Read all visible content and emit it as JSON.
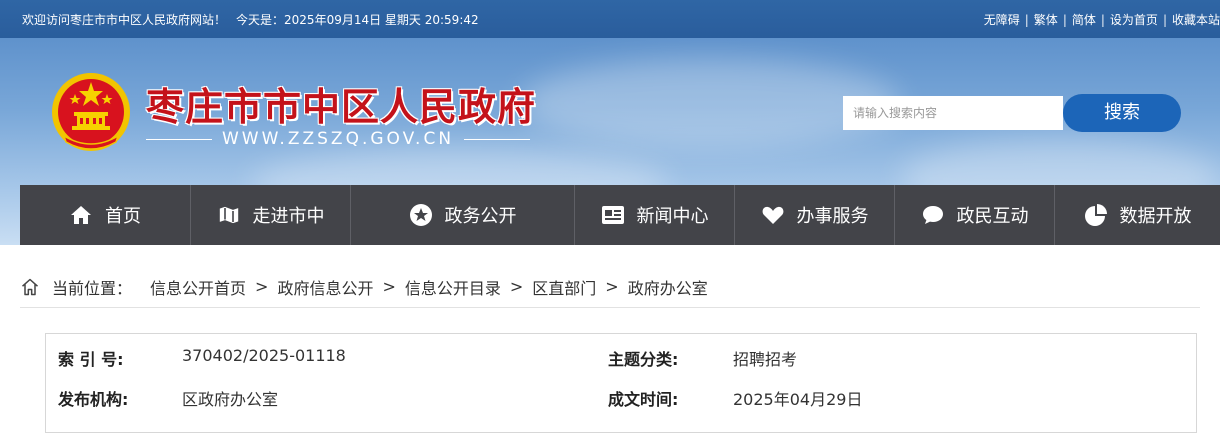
{
  "topbar": {
    "welcome": "欢迎访问枣庄市市中区人民政府网站！",
    "today_label": "今天是：",
    "datetime": "2025年09月14日 星期天 20:59:42",
    "links": [
      "无障碍",
      "繁体",
      "简体",
      "设为首页",
      "收藏本站"
    ]
  },
  "header": {
    "title": "枣庄市市中区人民政府",
    "domain": "WWW.ZZSZQ.GOV.CN",
    "search_placeholder": "请输入搜索内容",
    "search_button": "搜索"
  },
  "nav": {
    "items": [
      {
        "label": "首页",
        "icon": "home-icon"
      },
      {
        "label": "走进市中",
        "icon": "map-icon"
      },
      {
        "label": "政务公开",
        "icon": "star-badge-icon"
      },
      {
        "label": "新闻中心",
        "icon": "news-card-icon"
      },
      {
        "label": "办事服务",
        "icon": "heart-hand-icon"
      },
      {
        "label": "政民互动",
        "icon": "chat-bubble-icon"
      },
      {
        "label": "数据开放",
        "icon": "pie-chart-icon"
      }
    ]
  },
  "breadcrumb": {
    "label": "当前位置：",
    "items": [
      "信息公开首页",
      "政府信息公开",
      "信息公开目录",
      "区直部门",
      "政府办公室"
    ],
    "separator": ">"
  },
  "info": {
    "index_label": "索 引 号:",
    "index_value": "370402/2025-01118",
    "topic_label": "主题分类:",
    "topic_value": "招聘招考",
    "org_label": "发布机构:",
    "org_value": "区政府办公室",
    "date_label": "成文时间:",
    "date_value": "2025年04月29日"
  },
  "colors": {
    "topbar": "#2f66a5",
    "title_red": "#c4121a",
    "nav_bg": "#434449",
    "search_button": "#1c65b8"
  }
}
